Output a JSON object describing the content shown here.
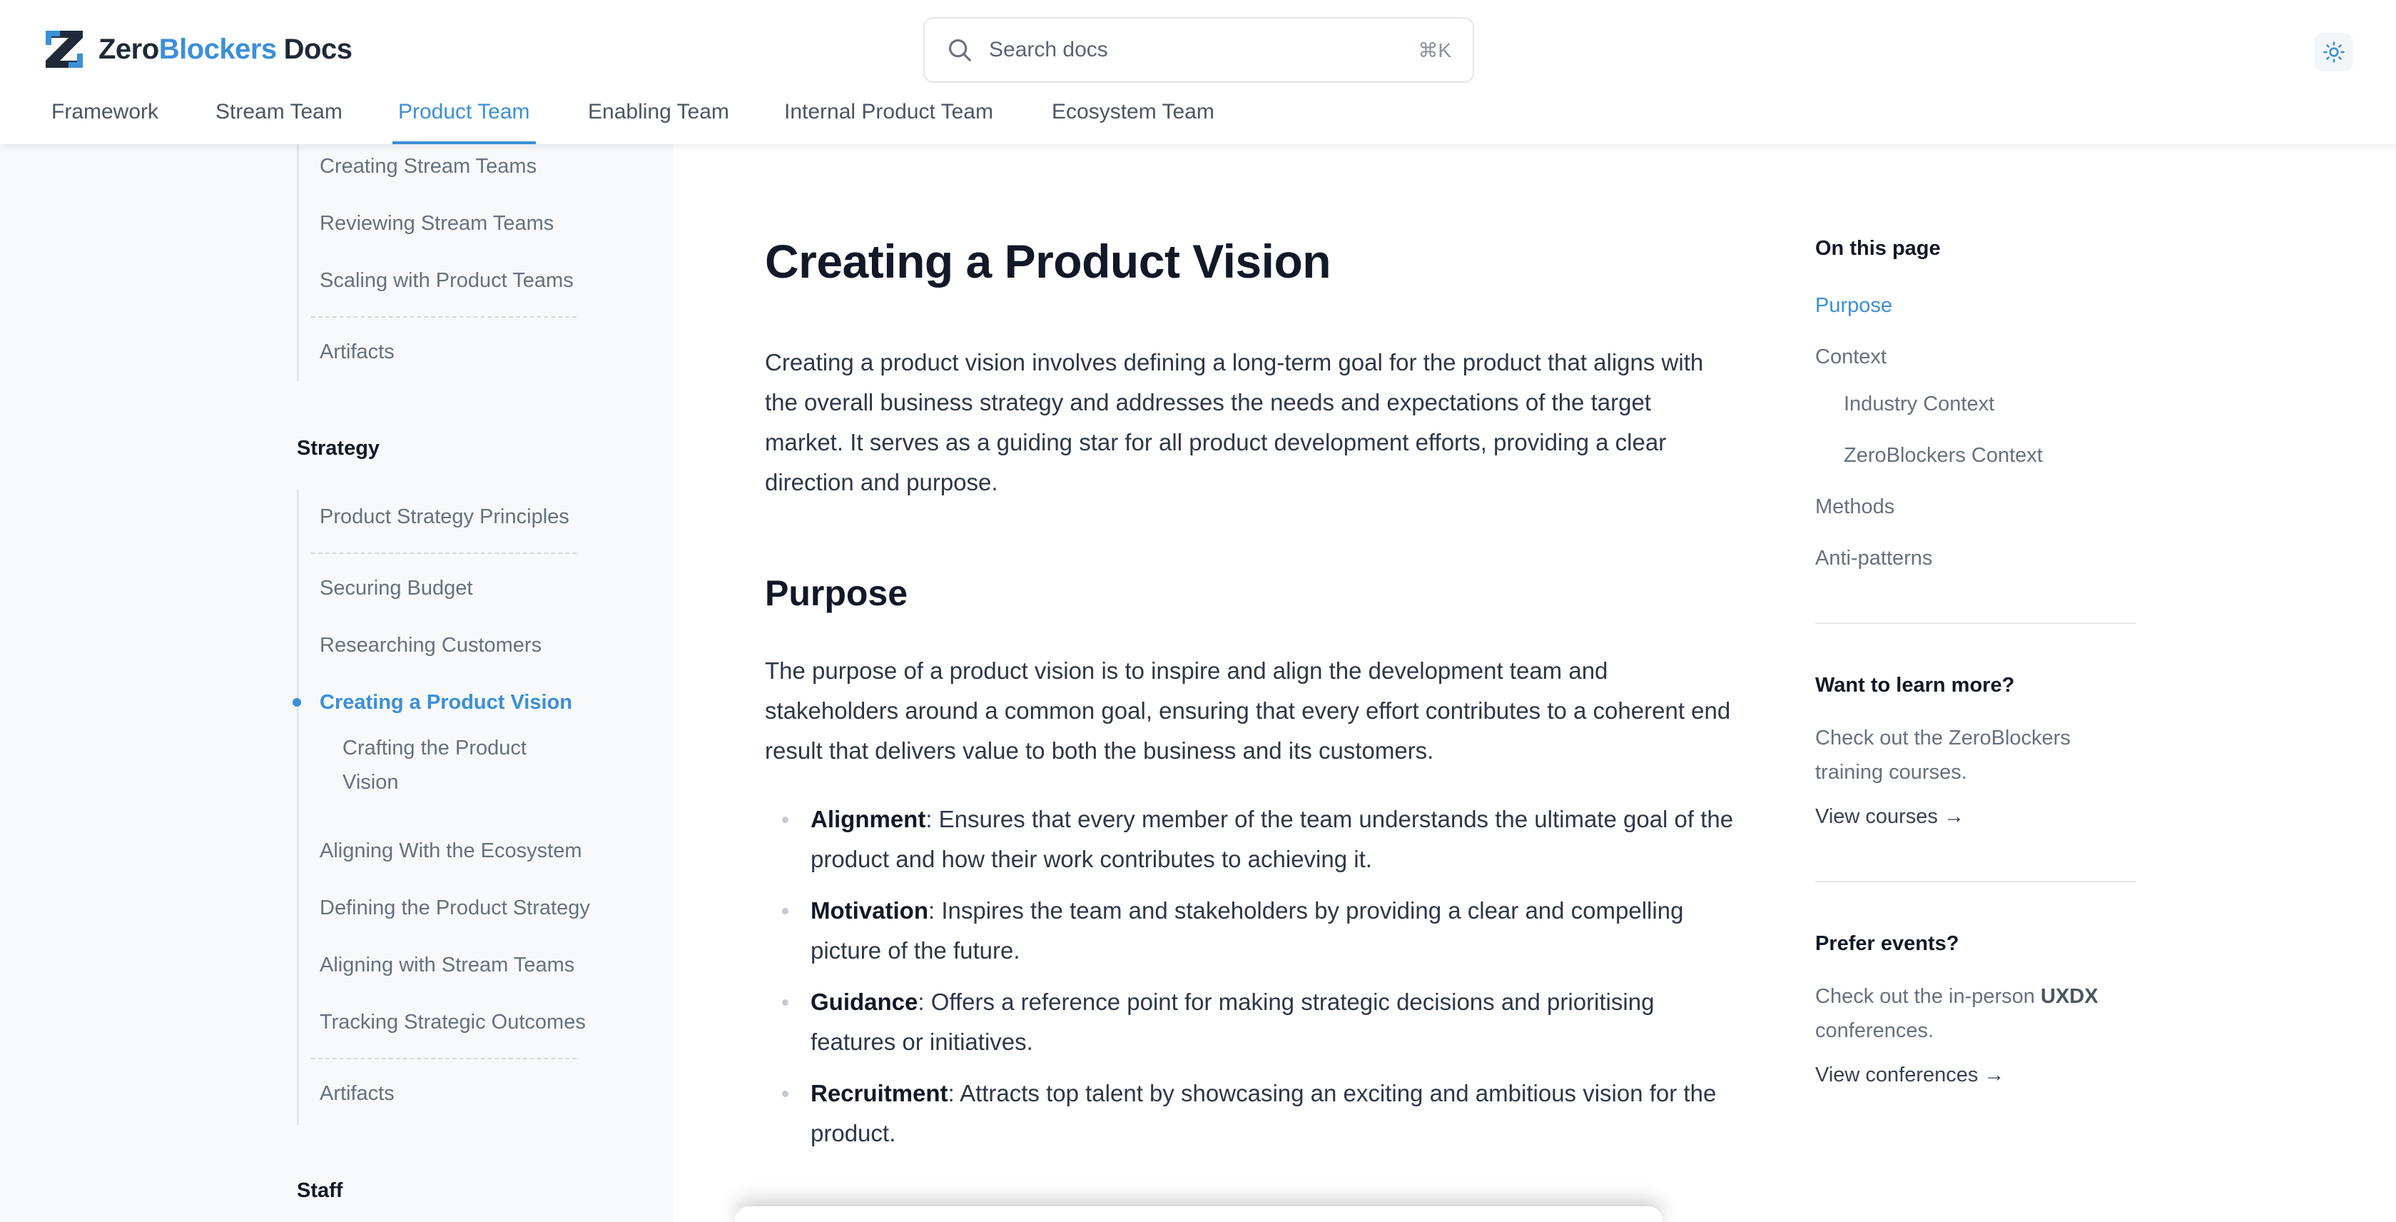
{
  "colors": {
    "accent": "#3b8fd9",
    "sidebar_bg": "#f7f9fb",
    "text": "#1f2937",
    "muted": "#667080"
  },
  "header": {
    "logo": {
      "zero": "Zero",
      "blockers": "Blockers",
      "docs": "Docs"
    },
    "search": {
      "placeholder": "Search docs",
      "shortcut": "⌘K",
      "icon": "search-icon"
    },
    "theme_icon": "sun-icon",
    "tabs": [
      {
        "label": "Framework"
      },
      {
        "label": "Stream Team"
      },
      {
        "label": "Product Team",
        "active": true
      },
      {
        "label": "Enabling Team"
      },
      {
        "label": "Internal Product Team"
      },
      {
        "label": "Ecosystem Team"
      }
    ]
  },
  "sidebar": {
    "group1": [
      {
        "label": "Creating Stream Teams"
      },
      {
        "label": "Reviewing Stream Teams"
      },
      {
        "label": "Scaling with Product Teams"
      },
      {
        "label": "Artifacts"
      }
    ],
    "strategy_heading": "Strategy",
    "strategy": [
      {
        "label": "Product Strategy Principles"
      },
      {
        "label": "Securing Budget"
      },
      {
        "label": "Researching Customers"
      },
      {
        "label": "Creating a Product Vision",
        "active": true
      },
      {
        "label": "Crafting the Product Vision",
        "sub": true
      },
      {
        "label": "Aligning With the Ecosystem"
      },
      {
        "label": "Defining the Product Strategy"
      },
      {
        "label": "Aligning with Stream Teams"
      },
      {
        "label": "Tracking Strategic Outcomes"
      },
      {
        "label": "Artifacts"
      }
    ],
    "staff_heading": "Staff"
  },
  "main": {
    "title": "Creating a Product Vision",
    "intro": "Creating a product vision involves defining a long-term goal for the product that aligns with the overall business strategy and addresses the needs and expectations of the target market. It serves as a guiding star for all product development efforts, providing a clear direction and purpose.",
    "purpose_heading": "Purpose",
    "purpose_text": "The purpose of a product vision is to inspire and align the development team and stakeholders around a common goal, ensuring that every effort contributes to a coherent end result that delivers value to both the business and its customers.",
    "bullets": [
      {
        "term": "Alignment",
        "text": ": Ensures that every member of the team understands the ultimate goal of the product and how their work contributes to achieving it."
      },
      {
        "term": "Motivation",
        "text": ": Inspires the team and stakeholders by providing a clear and compelling picture of the future."
      },
      {
        "term": "Guidance",
        "text": ": Offers a reference point for making strategic decisions and prioritising features or initiatives."
      },
      {
        "term": "Recruitment",
        "text": ": Attracts top talent by showcasing an exciting and ambitious vision for the product."
      }
    ]
  },
  "toc": {
    "title": "On this page",
    "links": [
      {
        "label": "Purpose",
        "active": true
      },
      {
        "label": "Context"
      },
      {
        "label": "Industry Context",
        "sub": true
      },
      {
        "label": "ZeroBlockers Context",
        "sub": true
      },
      {
        "label": "Methods"
      },
      {
        "label": "Anti-patterns"
      }
    ],
    "learn": {
      "heading": "Want to learn more?",
      "text": "Check out the ZeroBlockers training courses.",
      "cta": "View courses →"
    },
    "events": {
      "heading": "Prefer events?",
      "text_before": "Check out the in-person ",
      "brand": "UXDX",
      "text_after": " conferences.",
      "cta": "View conferences →"
    }
  }
}
